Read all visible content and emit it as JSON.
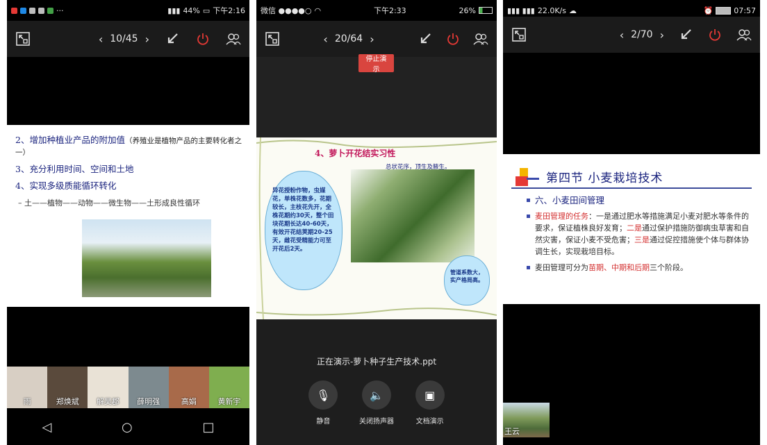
{
  "phone1": {
    "status": {
      "time": "下午2:16",
      "battery": "44%"
    },
    "pager": {
      "current": "10",
      "total": "45",
      "text": "10/45"
    },
    "slide": {
      "items": [
        {
          "text": "2、增加种植业产品的附加值",
          "note": "（养殖业是植物产品的主要转化者之一）"
        },
        {
          "text": "3、充分利用时间、空间和土地"
        },
        {
          "text": "4、实现多级质能循环转化"
        }
      ],
      "sub": "– 土——植物——动物——微生物——土形成良性循环"
    },
    "participants": [
      "雨",
      "郑焕斌",
      "解昊郡",
      "薛明强",
      "高娟",
      "黄新宇"
    ]
  },
  "phone2": {
    "status": {
      "carrier": "微信 ●●●●○",
      "time": "下午2:33",
      "battery": "26%"
    },
    "pager": {
      "current": "20",
      "total": "64",
      "text": "20/64"
    },
    "stop_button": "停止演示",
    "slide": {
      "title": "4、萝卜开花结实习性",
      "caption": "总状花序，顶生及腋生。",
      "bubble_text": "异花授粉作物，虫媒花，单株花数多，花期较长，主枝花先开，全株花期约30天，整个田块花期长达40-60天，有效开花结荚期20-25天，雌花受精能力可至开花后2天。",
      "bubble_small": "管道系数大，实产格局高。"
    },
    "presenting": "正在演示-萝卜种子生产技术.ppt",
    "controls": [
      "静音",
      "关闭扬声器",
      "文档演示"
    ]
  },
  "phone3": {
    "status": {
      "speed": "22.0K/s",
      "time": "07:57"
    },
    "pager": {
      "current": "2",
      "total": "70",
      "text": "2/70"
    },
    "slide": {
      "title": "第四节  小麦栽培技术",
      "heading": "六、小麦田间管理",
      "bullet1_lead": "麦田管理的任务",
      "bullet1_part1": "：一是通过肥水等措施满足小麦对肥水等条件的要求，保证植株良好发育；",
      "bullet1_two": "二是",
      "bullet1_part2": "通过保护措施防御病虫草害和自然灾害，保证小麦不受危害；",
      "bullet1_three": "三是",
      "bullet1_part3": "通过促控措施使个体与群体协调生长，实现栽培目标。",
      "bullet2_lead": "麦田管理可分为",
      "bullet2_red": "苗期、中期和后期",
      "bullet2_end": "三个阶段。"
    },
    "pip_name": "王云"
  }
}
